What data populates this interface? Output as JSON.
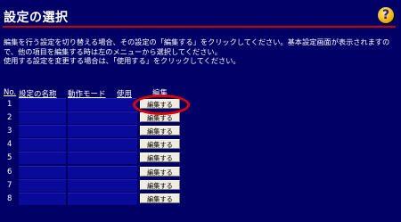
{
  "page": {
    "title": "設定の選択",
    "help_icon": "question-mark-help-icon",
    "description": "編集を行う設定を切り替える場合、その設定の「編集する」をクリックしてください。基本設定画面が表示されますので、他の項目を編集する時は左のメニューから選択してください。\n使用する設定を変更する場合は、「使用する」をクリックしてください。"
  },
  "table": {
    "headers": {
      "no": "No.",
      "name": "設定の名称",
      "mode": "動作モード",
      "use": "使用",
      "edit": "編集"
    },
    "rows": [
      {
        "no": "1",
        "edit_label": "編集する"
      },
      {
        "no": "2",
        "edit_label": "編集する"
      },
      {
        "no": "3",
        "edit_label": "編集する"
      },
      {
        "no": "4",
        "edit_label": "編集する"
      },
      {
        "no": "5",
        "edit_label": "編集する"
      },
      {
        "no": "6",
        "edit_label": "編集する"
      },
      {
        "no": "7",
        "edit_label": "編集する"
      },
      {
        "no": "8",
        "edit_label": "編集する"
      }
    ]
  },
  "colors": {
    "background": "#000066",
    "cell": "#0a0a99",
    "rule": "#cc0000",
    "highlight": "#e00000"
  }
}
